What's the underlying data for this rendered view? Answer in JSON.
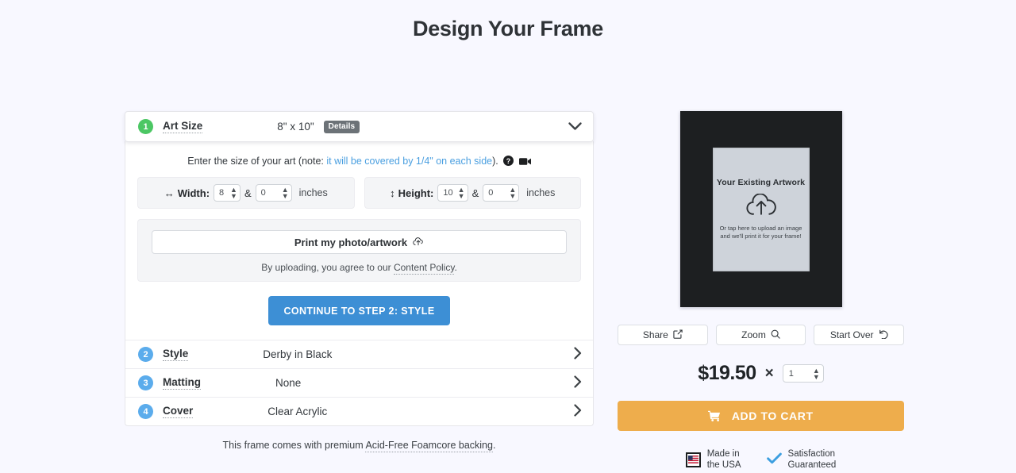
{
  "page": {
    "title": "Design Your Frame"
  },
  "colors": {
    "background": "#f8f8ff",
    "accent_blue": "#3d8fd5",
    "accent_orange": "#eead4c",
    "badge_green": "#4cc764",
    "badge_blue": "#5bacec",
    "frame": "#1d1f21",
    "art_placeholder": "#ced3da"
  },
  "steps": {
    "step1": {
      "number": "1",
      "label": "Art Size",
      "value": "8\" x 10\"",
      "details_label": "Details",
      "chevron": "chevron-down-icon",
      "hint_prefix": "Enter the size of your art (note:",
      "hint_link": "it will be covered by 1/4\" on each side",
      "hint_suffix": ").",
      "help_icon": "question-circle-icon",
      "video_icon": "video-camera-icon",
      "width": {
        "label": "Width:",
        "whole": "8",
        "amp": "&",
        "fraction": "0",
        "unit": "inches",
        "icon": "horizontal-arrows-icon"
      },
      "height": {
        "label": "Height:",
        "whole": "10",
        "amp": "&",
        "fraction": "0",
        "unit": "inches",
        "icon": "vertical-arrows-icon"
      },
      "upload_button": "Print my photo/artwork",
      "upload_icon": "cloud-upload-icon",
      "upload_note_prefix": "By uploading, you agree to our ",
      "upload_note_link": "Content Policy",
      "upload_note_suffix": ".",
      "continue_label": "CONTINUE TO STEP 2: STYLE"
    },
    "rest": [
      {
        "number": "2",
        "label": "Style",
        "value": "Derby in Black",
        "chevron": "chevron-right-icon"
      },
      {
        "number": "3",
        "label": "Matting",
        "value": "None",
        "chevron": "chevron-right-icon"
      },
      {
        "number": "4",
        "label": "Cover",
        "value": "Clear Acrylic",
        "chevron": "chevron-right-icon"
      }
    ]
  },
  "backing_note": {
    "prefix": "This frame comes with premium ",
    "link": "Acid-Free Foamcore backing",
    "suffix": "."
  },
  "preview": {
    "art_title": "Your Existing Artwork",
    "upload_icon": "cloud-upload-icon",
    "art_sub_line1": "Or tap here to upload an image",
    "art_sub_line2": "and we'll print it for your frame!",
    "actions": [
      {
        "label": "Share",
        "icon": "share-icon"
      },
      {
        "label": "Zoom",
        "icon": "magnifier-icon"
      },
      {
        "label": "Start Over",
        "icon": "undo-icon"
      }
    ]
  },
  "purchase": {
    "price": "$19.50",
    "times": "×",
    "quantity": "1",
    "cart_label": "ADD TO CART",
    "cart_icon": "shopping-cart-icon"
  },
  "trust": [
    {
      "icon": "usa-flag-icon",
      "line1": "Made in",
      "line2": "the USA"
    },
    {
      "icon": "check-icon",
      "line1": "Satisfaction",
      "line2": "Guaranteed"
    }
  ]
}
